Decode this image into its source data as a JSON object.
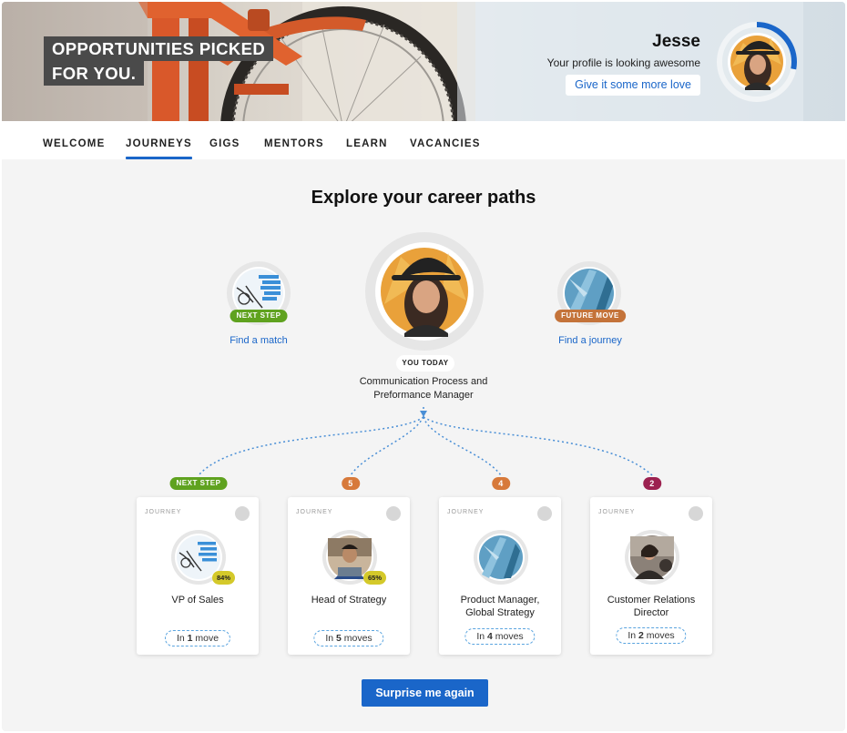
{
  "banner": {
    "headline_lines": [
      "OPPORTUNITIES PICKED",
      "FOR YOU."
    ],
    "profile": {
      "name": "Jesse",
      "status": "Your profile is looking awesome",
      "cta": "Give it some more love",
      "completion": 0.28
    }
  },
  "nav": {
    "tabs": [
      {
        "label": "WELCOME",
        "active": false
      },
      {
        "label": "JOURNEYS",
        "active": true
      },
      {
        "label": "GIGS",
        "active": false
      },
      {
        "label": "MENTORS",
        "active": false
      },
      {
        "label": "LEARN",
        "active": false
      },
      {
        "label": "VACANCIES",
        "active": false
      }
    ]
  },
  "main": {
    "title": "Explore your career paths",
    "left_node": {
      "badge": "NEXT STEP",
      "link": "Find a match",
      "badge_color": "#5fa21f"
    },
    "center_node": {
      "badge": "YOU TODAY",
      "role_lines": [
        "Communication Process and",
        "Preformance Manager"
      ]
    },
    "right_node": {
      "badge": "FUTURE MOVE",
      "link": "Find a journey",
      "badge_color": "#c4733a"
    },
    "paths": [
      {
        "marker": "NEXT STEP",
        "marker_color": "#5fa21f"
      },
      {
        "marker": "5",
        "marker_color": "#d7793a"
      },
      {
        "marker": "4",
        "marker_color": "#d7793a"
      },
      {
        "marker": "2",
        "marker_color": "#9c2150"
      }
    ],
    "cards": [
      {
        "tag": "JOURNEY",
        "title_lines": [
          "VP of Sales"
        ],
        "match": "84%",
        "moves_prefix": "In ",
        "moves_count": "1",
        "moves_suffix": " move"
      },
      {
        "tag": "JOURNEY",
        "title_lines": [
          "Head of Strategy"
        ],
        "match": "65%",
        "moves_prefix": "In ",
        "moves_count": "5",
        "moves_suffix": " moves"
      },
      {
        "tag": "JOURNEY",
        "title_lines": [
          "Product Manager,",
          "Global Strategy"
        ],
        "match": "",
        "moves_prefix": "In ",
        "moves_count": "4",
        "moves_suffix": " moves"
      },
      {
        "tag": "JOURNEY",
        "title_lines": [
          "Customer Relations",
          "Director"
        ],
        "match": "",
        "moves_prefix": "In ",
        "moves_count": "2",
        "moves_suffix": " moves"
      }
    ],
    "cta": "Surprise me again"
  },
  "colors": {
    "accent": "#1a66c9",
    "next_step": "#5fa21f",
    "moves_orange": "#d7793a",
    "moves_plum": "#9c2150",
    "match_yellow": "#d4c92a"
  },
  "icons": {
    "card_save": "bookmark-icon"
  }
}
